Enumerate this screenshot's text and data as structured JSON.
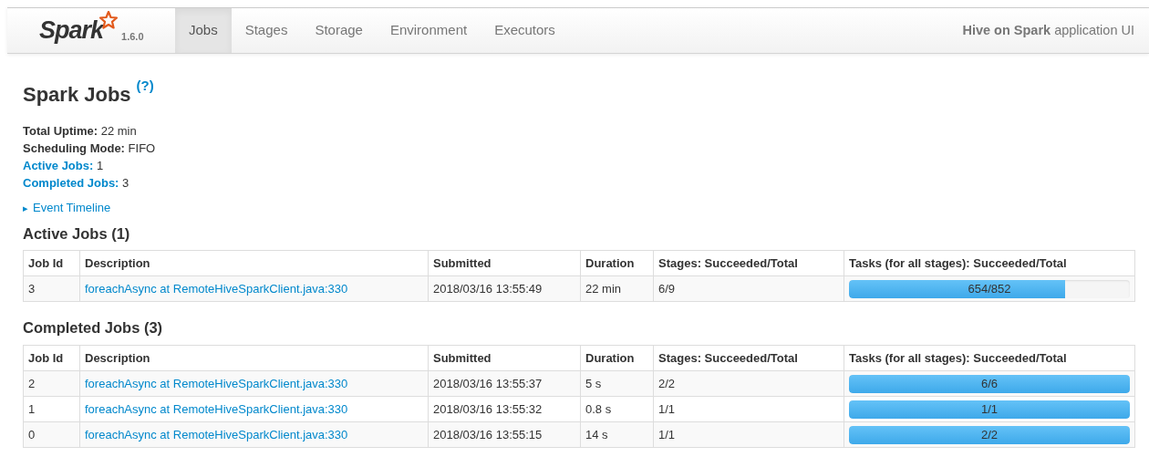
{
  "navbar": {
    "logo": "Spark",
    "version": "1.6.0",
    "tabs": [
      {
        "label": "Jobs",
        "selected": true
      },
      {
        "label": "Stages",
        "selected": false
      },
      {
        "label": "Storage",
        "selected": false
      },
      {
        "label": "Environment",
        "selected": false
      },
      {
        "label": "Executors",
        "selected": false
      }
    ],
    "app_name": "Hive on Spark",
    "app_suffix": "application UI"
  },
  "title": "Spark Jobs",
  "help": "(?)",
  "summary": [
    {
      "label": "Total Uptime:",
      "value": "22 min",
      "kind": "text"
    },
    {
      "label": "Scheduling Mode:",
      "value": "FIFO",
      "kind": "text"
    },
    {
      "label": "Active Jobs:",
      "value": "1",
      "kind": "link"
    },
    {
      "label": "Completed Jobs:",
      "value": "3",
      "kind": "link"
    }
  ],
  "timeline": {
    "arrow": "▸",
    "label": "Event Timeline",
    "expanded": false
  },
  "tables": [
    {
      "heading": "Active Jobs (1)",
      "columns": [
        "Job Id",
        "Description",
        "Submitted",
        "Duration",
        "Stages: Succeeded/Total",
        "Tasks (for all stages): Succeeded/Total"
      ],
      "rows": [
        {
          "id": "3",
          "description": "foreachAsync at RemoteHiveSparkClient.java:330",
          "submitted": "2018/03/16 13:55:49",
          "duration": "22 min",
          "stages": "6/9",
          "tasks": "654/852",
          "level": 0.768
        }
      ]
    },
    {
      "heading": "Completed Jobs (3)",
      "columns": [
        "Job Id",
        "Description",
        "Submitted",
        "Duration",
        "Stages: Succeeded/Total",
        "Tasks (for all stages): Succeeded/Total"
      ],
      "rows": [
        {
          "id": "2",
          "description": "foreachAsync at RemoteHiveSparkClient.java:330",
          "submitted": "2018/03/16 13:55:37",
          "duration": "5 s",
          "stages": "2/2",
          "tasks": "6/6",
          "level": 1
        },
        {
          "id": "1",
          "description": "foreachAsync at RemoteHiveSparkClient.java:330",
          "submitted": "2018/03/16 13:55:32",
          "duration": "0.8 s",
          "stages": "1/1",
          "tasks": "1/1",
          "level": 1
        },
        {
          "id": "0",
          "description": "foreachAsync at RemoteHiveSparkClient.java:330",
          "submitted": "2018/03/16 13:55:15",
          "duration": "14 s",
          "stages": "1/1",
          "tasks": "2/2",
          "level": 1
        }
      ]
    }
  ]
}
